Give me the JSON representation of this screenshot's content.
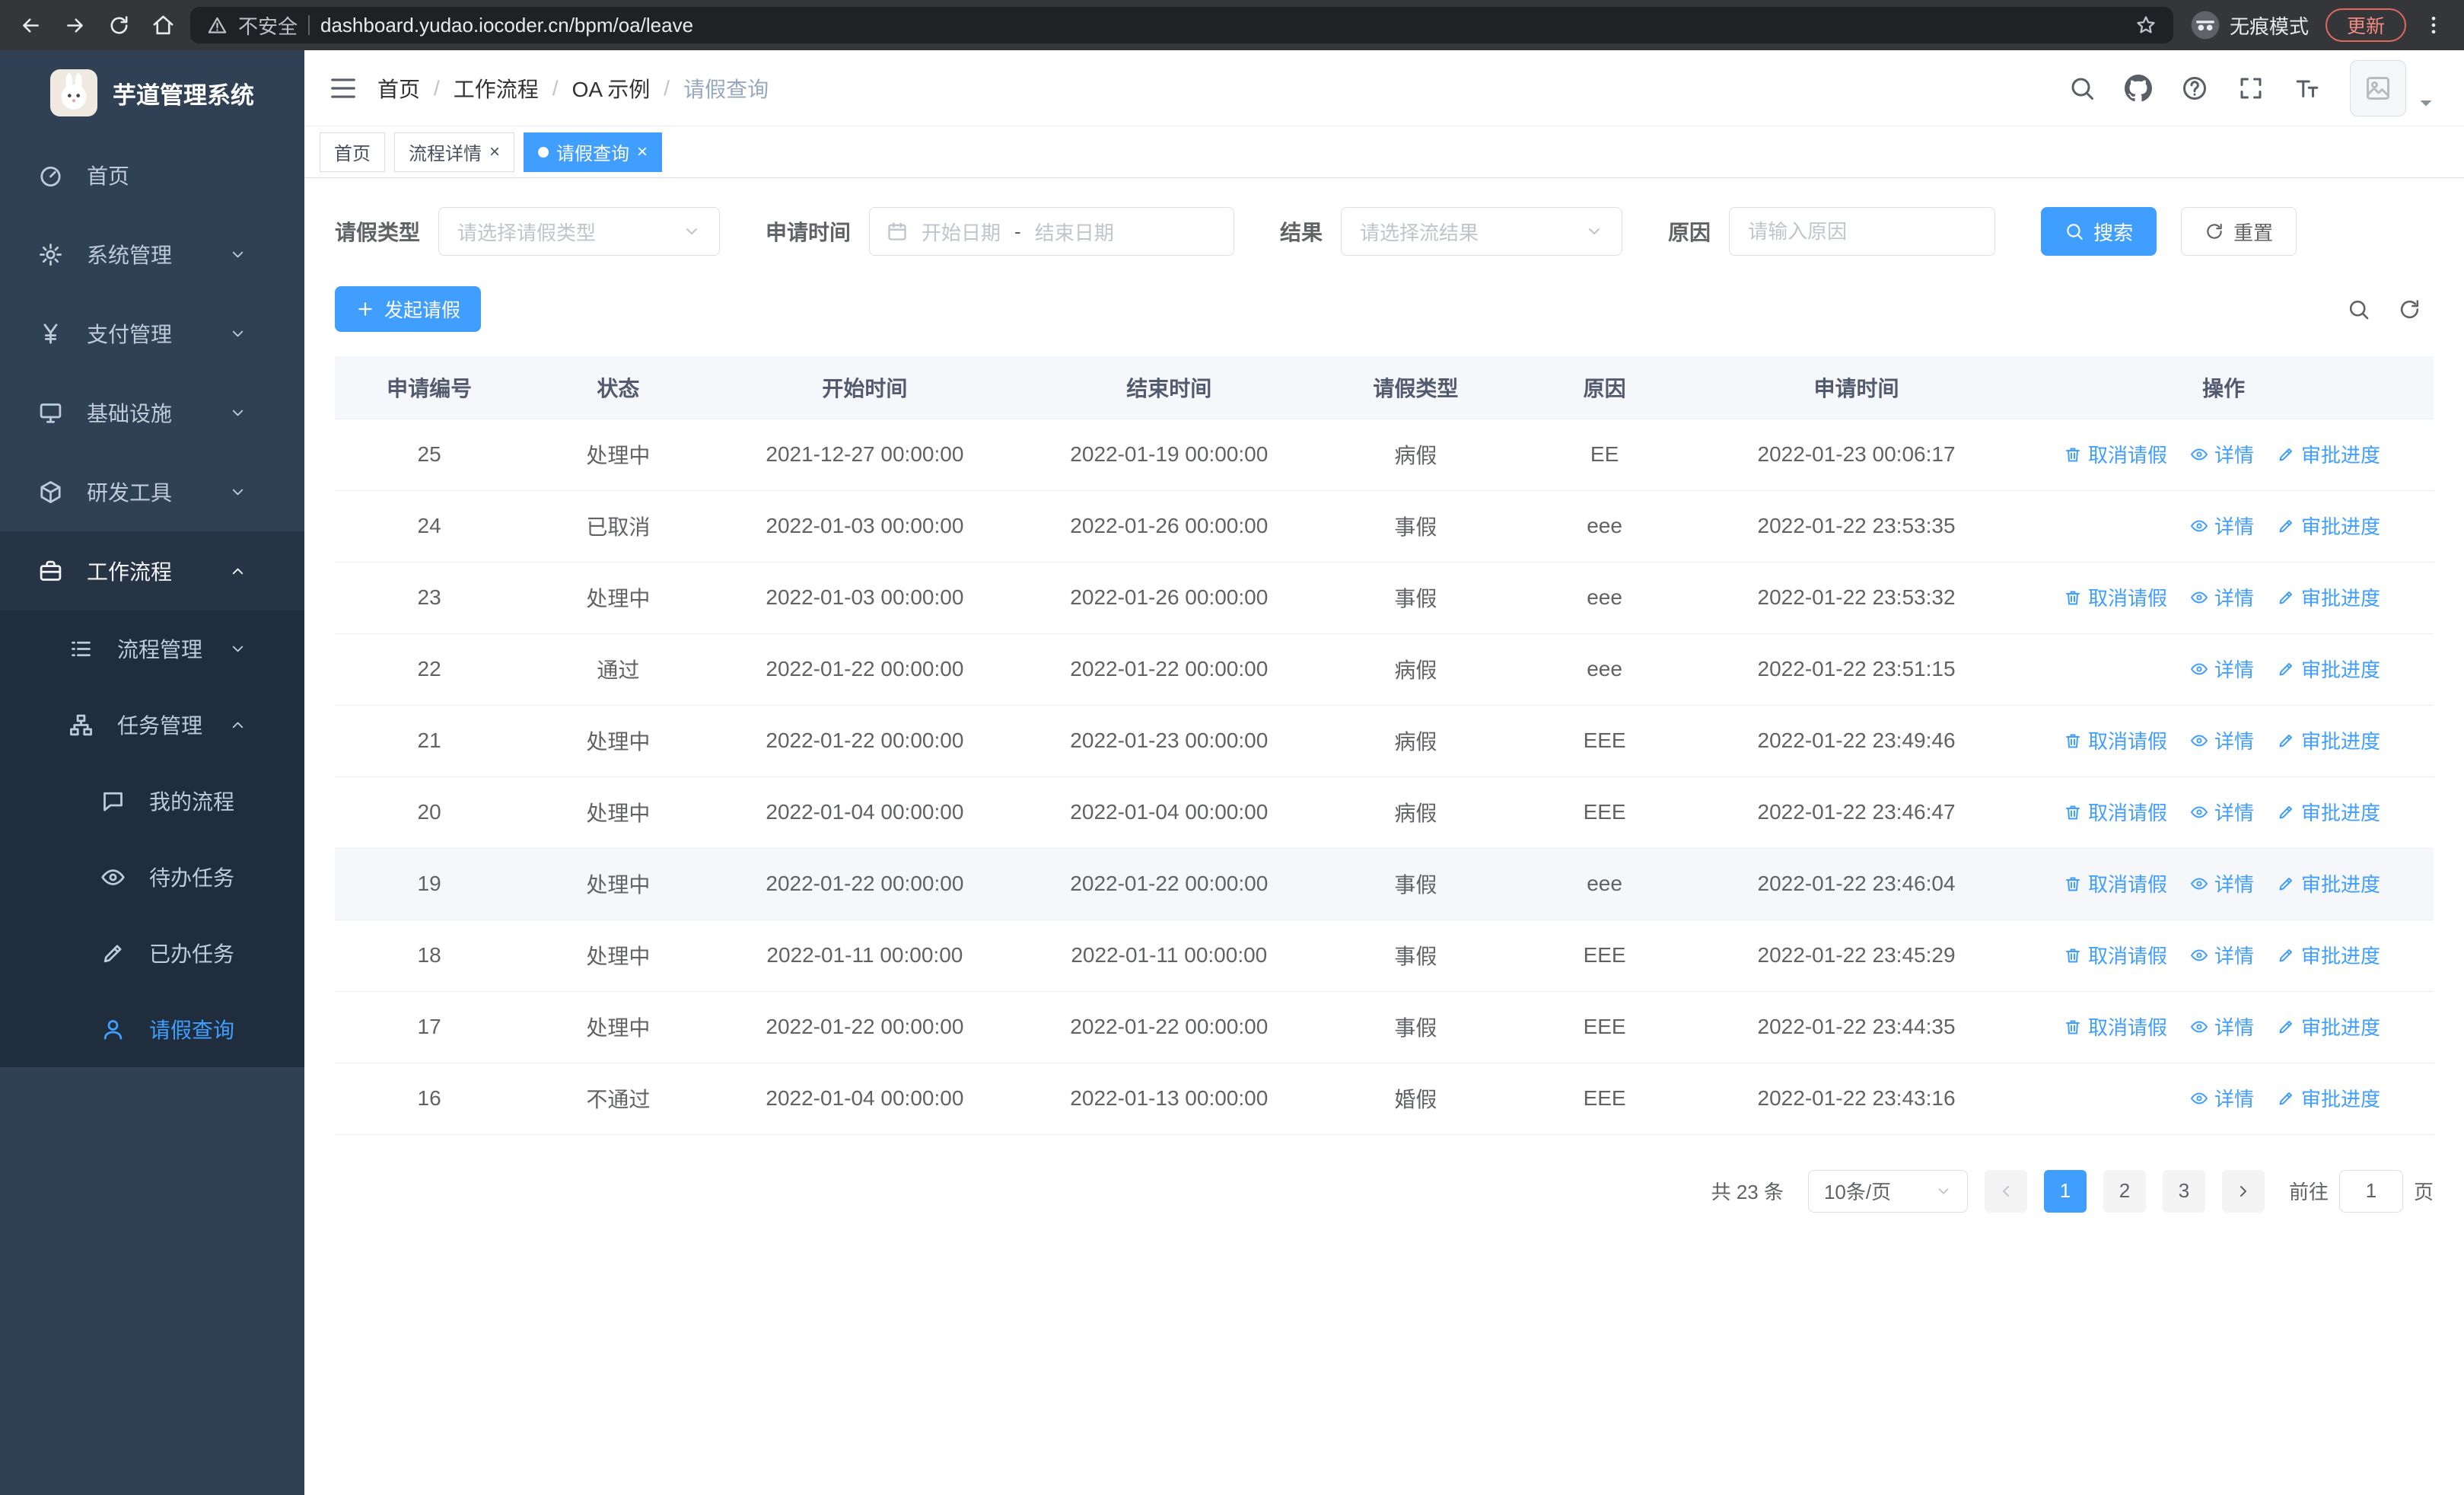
{
  "browser": {
    "security_label": "不安全",
    "url": "dashboard.yudao.iocoder.cn/bpm/oa/leave",
    "incognito_label": "无痕模式",
    "update_label": "更新"
  },
  "sidebar": {
    "title": "芋道管理系统",
    "menu": [
      {
        "key": "home",
        "label": "首页",
        "icon": "dashboard",
        "level": 1
      },
      {
        "key": "system",
        "label": "系统管理",
        "icon": "gear",
        "level": 1,
        "chevron": "down"
      },
      {
        "key": "payment",
        "label": "支付管理",
        "icon": "yen",
        "level": 1,
        "chevron": "down"
      },
      {
        "key": "infrastructure",
        "label": "基础设施",
        "icon": "monitor",
        "level": 1,
        "chevron": "down"
      },
      {
        "key": "devtools",
        "label": "研发工具",
        "icon": "cube",
        "level": 1,
        "chevron": "down"
      },
      {
        "key": "workflow",
        "label": "工作流程",
        "icon": "briefcase",
        "level": 1,
        "chevron": "up",
        "open": true,
        "children": [
          {
            "key": "process-mgmt",
            "label": "流程管理",
            "icon": "list",
            "level": 2,
            "chevron": "down"
          },
          {
            "key": "task-mgmt",
            "label": "任务管理",
            "icon": "tree",
            "level": 2,
            "chevron": "up",
            "open": true,
            "children": [
              {
                "key": "my-process",
                "label": "我的流程",
                "icon": "chat",
                "level": 3
              },
              {
                "key": "todo-tasks",
                "label": "待办任务",
                "icon": "eye",
                "level": 3
              },
              {
                "key": "done-tasks",
                "label": "已办任务",
                "icon": "marker",
                "level": 3
              },
              {
                "key": "leave-query",
                "label": "请假查询",
                "icon": "user",
                "level": 3,
                "active": true
              }
            ]
          }
        ]
      }
    ]
  },
  "navbar": {
    "breadcrumb": [
      "首页",
      "工作流程",
      "OA 示例",
      "请假查询"
    ]
  },
  "tabs": [
    {
      "key": "home",
      "label": "首页",
      "closable": false,
      "active": false
    },
    {
      "key": "process-detail",
      "label": "流程详情",
      "closable": true,
      "active": false
    },
    {
      "key": "leave-query",
      "label": "请假查询",
      "closable": true,
      "active": true
    }
  ],
  "filters": {
    "leave_type": {
      "label": "请假类型",
      "placeholder": "请选择请假类型"
    },
    "apply_time": {
      "label": "申请时间",
      "start_placeholder": "开始日期",
      "separator": "-",
      "end_placeholder": "结束日期"
    },
    "result": {
      "label": "结果",
      "placeholder": "请选择流结果"
    },
    "reason": {
      "label": "原因",
      "placeholder": "请输入原因"
    },
    "search_label": "搜索",
    "reset_label": "重置"
  },
  "toolbar": {
    "create_label": "发起请假"
  },
  "table": {
    "columns": [
      "申请编号",
      "状态",
      "开始时间",
      "结束时间",
      "请假类型",
      "原因",
      "申请时间",
      "操作"
    ],
    "action_labels": {
      "cancel": "取消请假",
      "detail": "详情",
      "progress": "审批进度"
    },
    "rows": [
      {
        "id": "25",
        "status": "处理中",
        "start": "2021-12-27 00:00:00",
        "end": "2022-01-19 00:00:00",
        "type": "病假",
        "reason": "EE",
        "applied": "2022-01-23 00:06:17",
        "actions": [
          "cancel",
          "detail",
          "progress"
        ]
      },
      {
        "id": "24",
        "status": "已取消",
        "start": "2022-01-03 00:00:00",
        "end": "2022-01-26 00:00:00",
        "type": "事假",
        "reason": "eee",
        "applied": "2022-01-22 23:53:35",
        "actions": [
          "detail",
          "progress"
        ]
      },
      {
        "id": "23",
        "status": "处理中",
        "start": "2022-01-03 00:00:00",
        "end": "2022-01-26 00:00:00",
        "type": "事假",
        "reason": "eee",
        "applied": "2022-01-22 23:53:32",
        "actions": [
          "cancel",
          "detail",
          "progress"
        ]
      },
      {
        "id": "22",
        "status": "通过",
        "start": "2022-01-22 00:00:00",
        "end": "2022-01-22 00:00:00",
        "type": "病假",
        "reason": "eee",
        "applied": "2022-01-22 23:51:15",
        "actions": [
          "detail",
          "progress"
        ]
      },
      {
        "id": "21",
        "status": "处理中",
        "start": "2022-01-22 00:00:00",
        "end": "2022-01-23 00:00:00",
        "type": "病假",
        "reason": "EEE",
        "applied": "2022-01-22 23:49:46",
        "actions": [
          "cancel",
          "detail",
          "progress"
        ]
      },
      {
        "id": "20",
        "status": "处理中",
        "start": "2022-01-04 00:00:00",
        "end": "2022-01-04 00:00:00",
        "type": "病假",
        "reason": "EEE",
        "applied": "2022-01-22 23:46:47",
        "actions": [
          "cancel",
          "detail",
          "progress"
        ]
      },
      {
        "id": "19",
        "status": "处理中",
        "start": "2022-01-22 00:00:00",
        "end": "2022-01-22 00:00:00",
        "type": "事假",
        "reason": "eee",
        "applied": "2022-01-22 23:46:04",
        "actions": [
          "cancel",
          "detail",
          "progress"
        ],
        "highlighted": true
      },
      {
        "id": "18",
        "status": "处理中",
        "start": "2022-01-11 00:00:00",
        "end": "2022-01-11 00:00:00",
        "type": "事假",
        "reason": "EEE",
        "applied": "2022-01-22 23:45:29",
        "actions": [
          "cancel",
          "detail",
          "progress"
        ]
      },
      {
        "id": "17",
        "status": "处理中",
        "start": "2022-01-22 00:00:00",
        "end": "2022-01-22 00:00:00",
        "type": "事假",
        "reason": "EEE",
        "applied": "2022-01-22 23:44:35",
        "actions": [
          "cancel",
          "detail",
          "progress"
        ]
      },
      {
        "id": "16",
        "status": "不通过",
        "start": "2022-01-04 00:00:00",
        "end": "2022-01-13 00:00:00",
        "type": "婚假",
        "reason": "EEE",
        "applied": "2022-01-22 23:43:16",
        "actions": [
          "detail",
          "progress"
        ]
      }
    ]
  },
  "pagination": {
    "total_label": "共 23 条",
    "page_size": "10条/页",
    "pages": [
      "1",
      "2",
      "3"
    ],
    "active_page": "1",
    "goto_label": "前往",
    "goto_value": "1",
    "goto_suffix": "页"
  },
  "colors": {
    "primary": "#409eff",
    "sidebar_bg": "#304156",
    "submenu_bg": "#1f2d3d"
  }
}
